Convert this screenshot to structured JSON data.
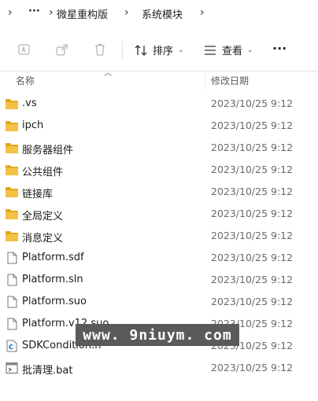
{
  "breadcrumb": {
    "items": [
      "微星重构版",
      "系统模块"
    ],
    "more_label": "···"
  },
  "toolbar": {
    "sort_label": "排序",
    "view_label": "查看",
    "more_label": "···"
  },
  "columns": {
    "name": "名称",
    "modified": "修改日期"
  },
  "files": [
    {
      "name": ".vs",
      "date": "2023/10/25 9:12",
      "icon": "folder-icon"
    },
    {
      "name": "ipch",
      "date": "2023/10/25 9:12",
      "icon": "folder-icon"
    },
    {
      "name": "服务器组件",
      "date": "2023/10/25 9:12",
      "icon": "folder-icon"
    },
    {
      "name": "公共组件",
      "date": "2023/10/25 9:12",
      "icon": "folder-icon"
    },
    {
      "name": "链接库",
      "date": "2023/10/25 9:12",
      "icon": "folder-icon"
    },
    {
      "name": "全局定义",
      "date": "2023/10/25 9:12",
      "icon": "folder-icon"
    },
    {
      "name": "消息定义",
      "date": "2023/10/25 9:12",
      "icon": "folder-icon"
    },
    {
      "name": "Platform.sdf",
      "date": "2023/10/25 9:12",
      "icon": "file-icon"
    },
    {
      "name": "Platform.sln",
      "date": "2023/10/25 9:12",
      "icon": "file-icon"
    },
    {
      "name": "Platform.suo",
      "date": "2023/10/25 9:12",
      "icon": "file-icon"
    },
    {
      "name": "Platform.v12.suo",
      "date": "2023/10/25 9:12",
      "icon": "file-icon"
    },
    {
      "name": "SDKCondition.h",
      "date": "2023/10/25 9:12",
      "icon": "c-header-file-icon"
    },
    {
      "name": "批清理.bat",
      "date": "2023/10/25 9:12",
      "icon": "batch-file-icon"
    }
  ],
  "watermark": "www. 9niuym. com",
  "colors": {
    "folder": "#f4c145",
    "folder_dark": "#e2a822",
    "accent": "#0067c0"
  }
}
